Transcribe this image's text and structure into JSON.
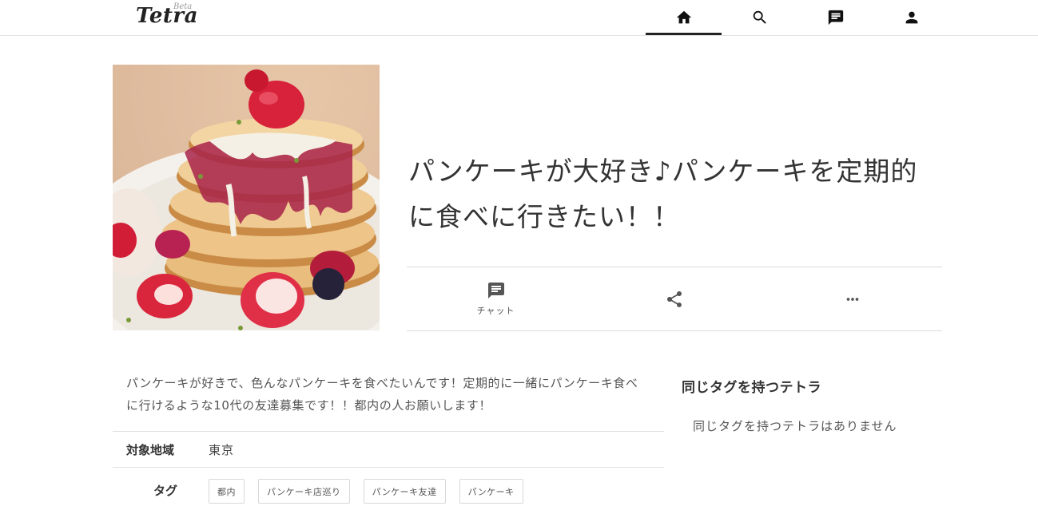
{
  "app": {
    "logo_main": "Tetra",
    "logo_sub": "Beta"
  },
  "nav": {
    "items": [
      {
        "icon": "home-icon",
        "active": true
      },
      {
        "icon": "search-icon",
        "active": false
      },
      {
        "icon": "chat-icon",
        "active": false
      },
      {
        "icon": "user-icon",
        "active": false
      }
    ]
  },
  "post": {
    "title": "パンケーキが大好き♪パンケーキを定期的に食べに行きたい！！",
    "image_alt": "strawberry-pancake-stack",
    "actions": {
      "chat_label": "チャット",
      "share_icon": "share-icon",
      "more_icon": "more-horizontal-icon"
    },
    "description": "パンケーキが好きで、色んなパンケーキを食べたいんです！定期的に一緒にパンケーキ食べに行けるような10代の友達募集です！！都内の人お願いします！",
    "region_label": "対象地域",
    "region_value": "東京",
    "tags_label": "タグ",
    "tags": [
      "都内",
      "パンケーキ店巡り",
      "パンケーキ友達",
      "パンケーキ"
    ]
  },
  "sidebar": {
    "title": "同じタグを持つテトラ",
    "empty_message": "同じタグを持つテトラはありません"
  }
}
